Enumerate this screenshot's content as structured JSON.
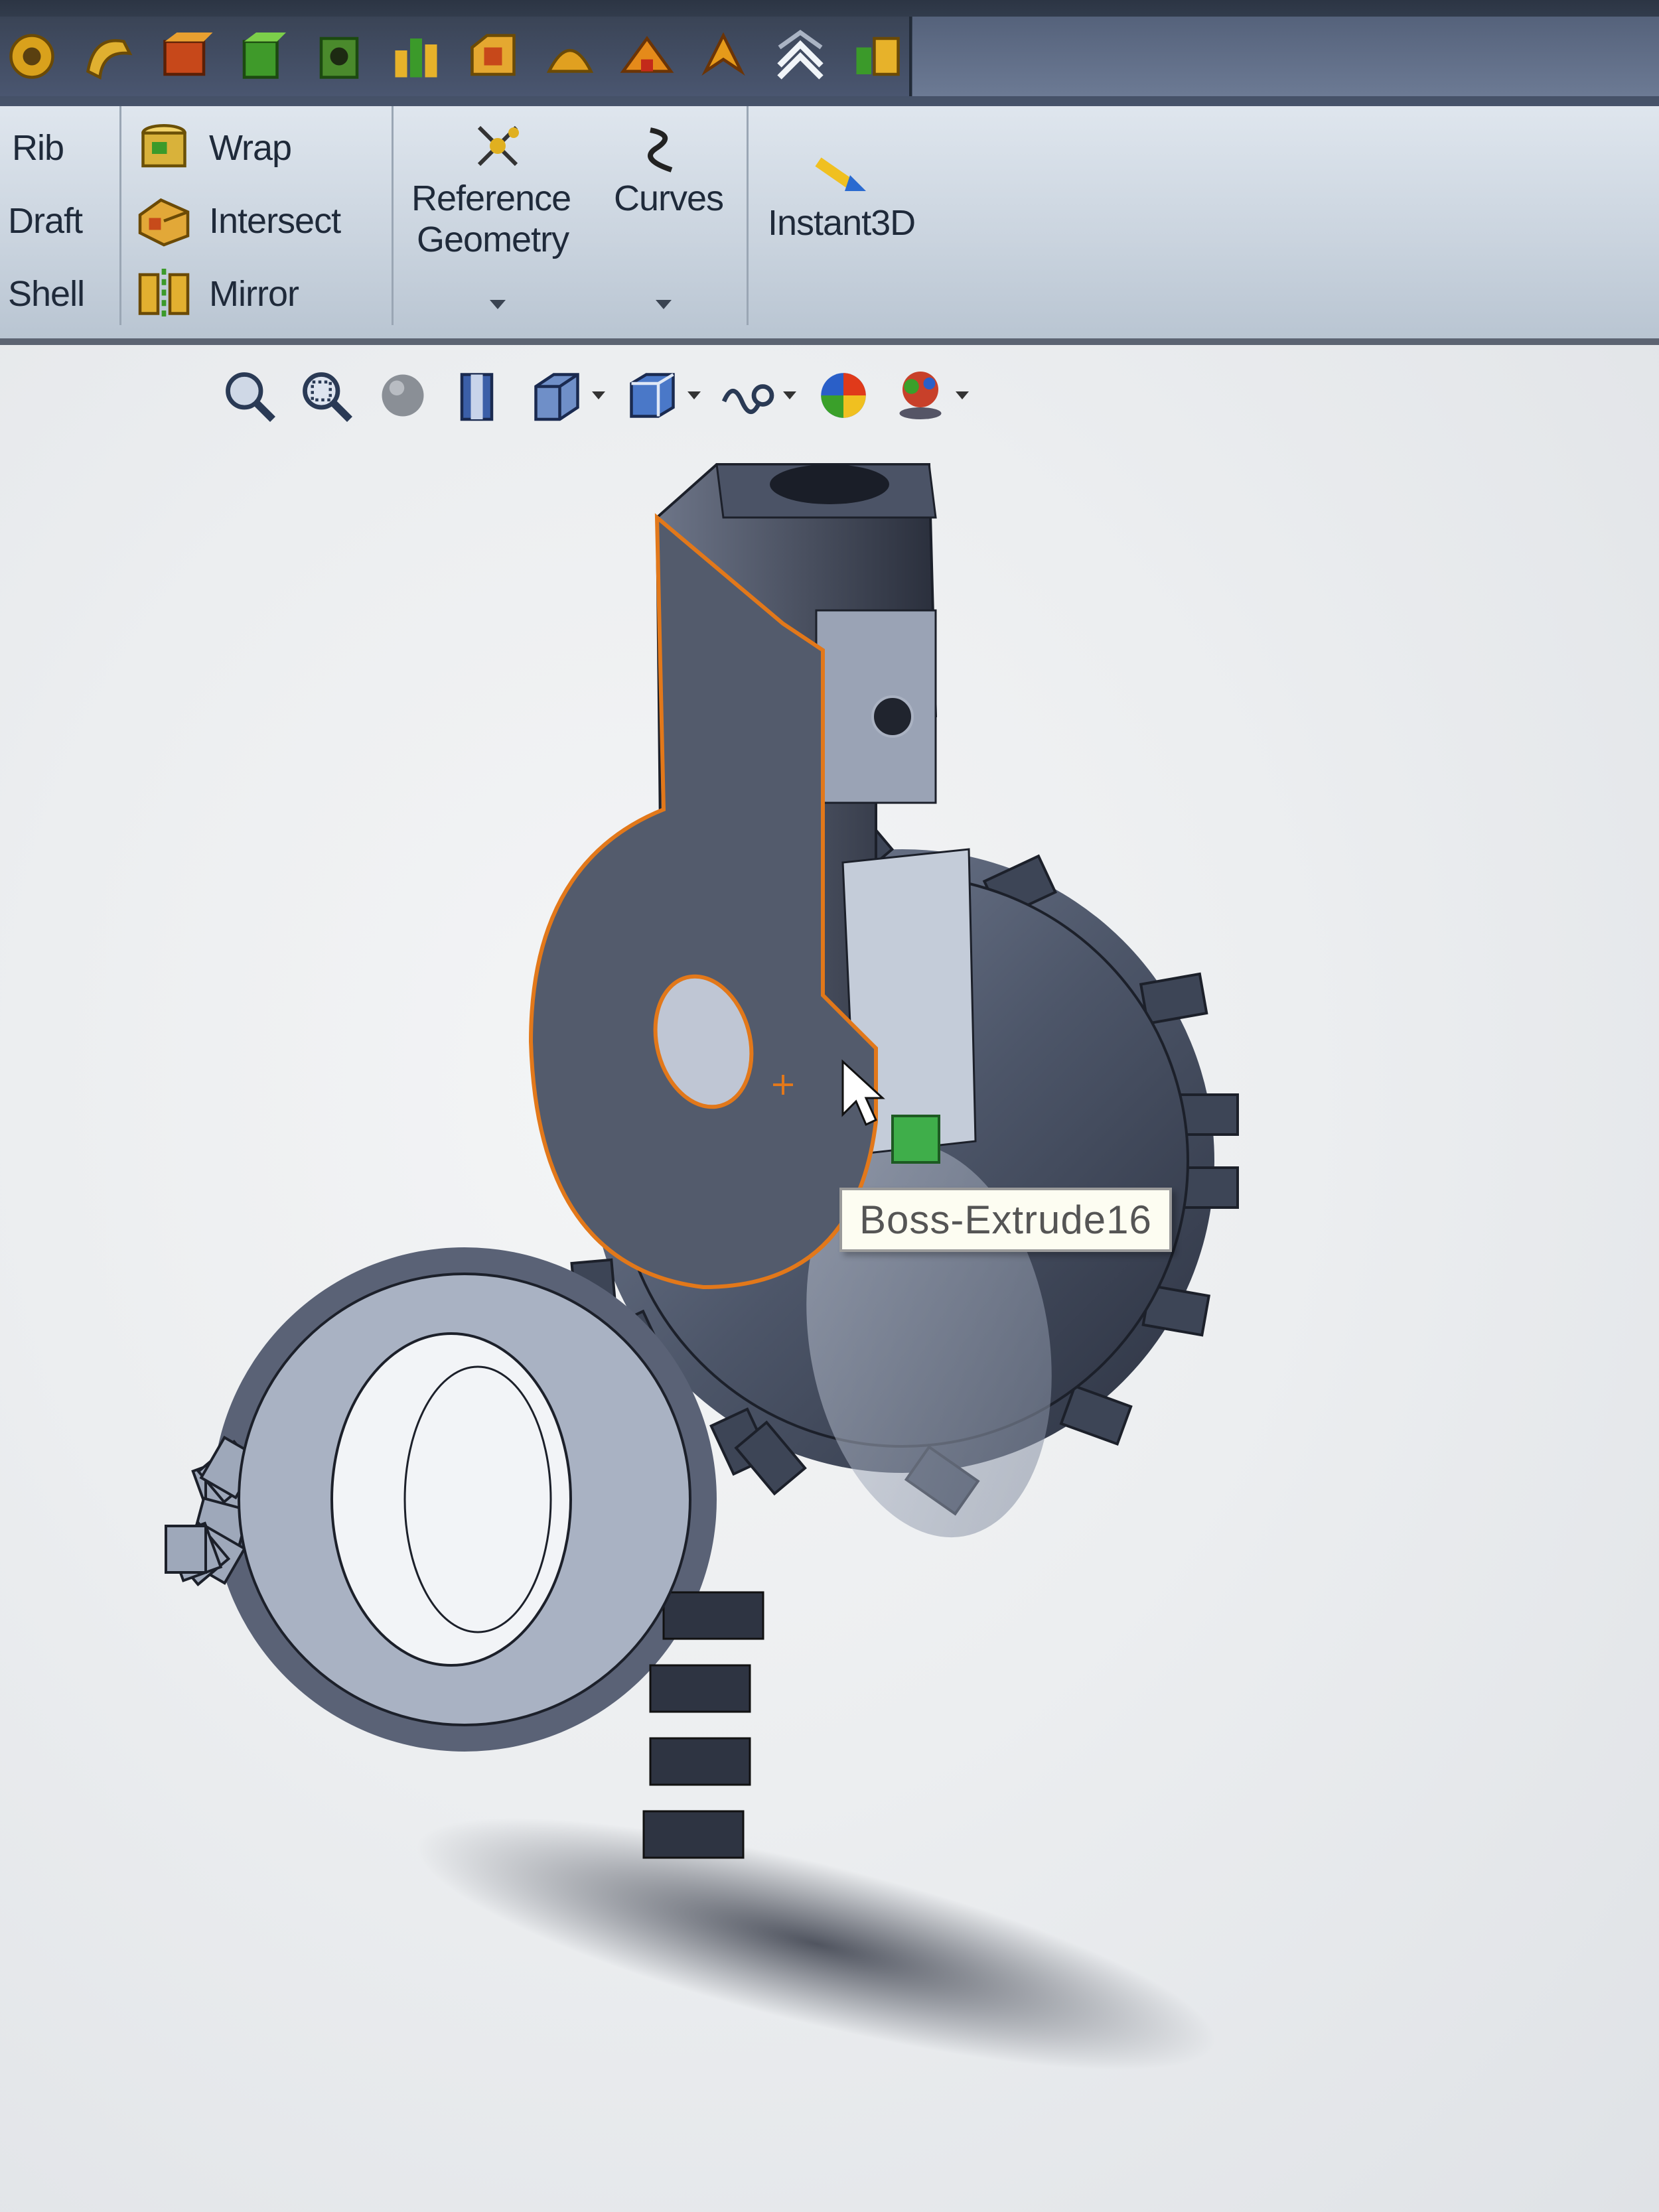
{
  "quick_access": {
    "icons": [
      "revolve-icon",
      "sweep-icon",
      "loft-icon",
      "extrude-cut-icon",
      "hole-icon",
      "rib-feature-icon",
      "loft-cut-icon",
      "dome-icon",
      "flex-icon",
      "deform-icon",
      "freeform-icon",
      "indent-icon"
    ]
  },
  "ribbon": {
    "col1": {
      "rib": "Rib",
      "draft": "Draft",
      "shell": "Shell"
    },
    "col2": {
      "wrap": "Wrap",
      "intersect": "Intersect",
      "mirror": "Mirror"
    },
    "reference_geometry": {
      "line1": "Reference",
      "line2": "Geometry"
    },
    "curves": "Curves",
    "instant3d": "Instant3D"
  },
  "heads_up": {
    "items": [
      "zoom-to-fit-icon",
      "zoom-to-area-icon",
      "previous-view-icon",
      "section-view-icon",
      "view-orientation-icon",
      "display-style-icon",
      "hide-show-items-icon",
      "edit-appearance-icon",
      "apply-scene-icon"
    ]
  },
  "viewport": {
    "tooltip": "Boss-Extrude16"
  },
  "colors": {
    "model_metal": "#4b5568",
    "selection_highlight": "#e2781a",
    "tooltip_bg": "#fdfdf2"
  }
}
